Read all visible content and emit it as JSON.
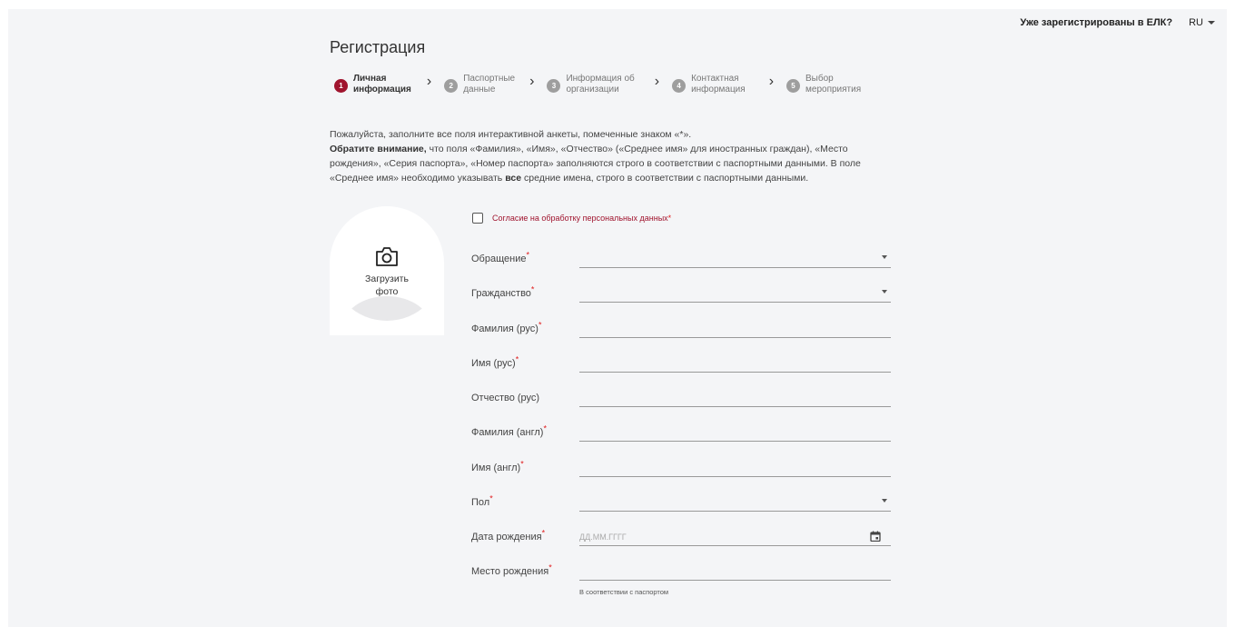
{
  "header": {
    "already_registered": "Уже зарегистрированы в ЕЛК?",
    "language": "RU"
  },
  "page_title": "Регистрация",
  "steps": [
    {
      "num": "1",
      "label": "Личная\nинформация",
      "active": true
    },
    {
      "num": "2",
      "label": "Паспортные\nданные",
      "active": false
    },
    {
      "num": "3",
      "label": "Информация об\nорганизации",
      "active": false
    },
    {
      "num": "4",
      "label": "Контактная\nинформация",
      "active": false
    },
    {
      "num": "5",
      "label": "Выбор\nмероприятия",
      "active": false
    }
  ],
  "intro": {
    "line1": "Пожалуйста, заполните все поля интерактивной анкеты, помеченные знаком «*».",
    "attention_bold": "Обратите внимание,",
    "attention_text": " что поля «Фамилия», «Имя», «Отчество» («Среднее имя» для иностранных граждан), «Место рождения», «Серия паспорта», «Номер паспорта» заполняются строго в соответствии с паспортными данными. В поле «Среднее имя» необходимо указывать ",
    "all_bold": "все",
    "tail": " средние имена, строго в соответствии с паспортными данными."
  },
  "photo": {
    "icon": "camera-icon",
    "label_line1": "Загрузить",
    "label_line2": "фото"
  },
  "consent": {
    "label": "Согласие на обработку персональных данных",
    "checked": false
  },
  "required_mark": "*",
  "form": {
    "salutation": {
      "label": "Обращение",
      "value": ""
    },
    "citizenship": {
      "label": "Гражданство",
      "value": ""
    },
    "last_name_ru": {
      "label": "Фамилия (рус)",
      "value": ""
    },
    "first_name_ru": {
      "label": "Имя (рус)",
      "value": ""
    },
    "patronymic_ru": {
      "label": "Отчество (рус)",
      "value": ""
    },
    "last_name_en": {
      "label": "Фамилия (англ)",
      "value": ""
    },
    "first_name_en": {
      "label": "Имя (англ)",
      "value": ""
    },
    "gender": {
      "label": "Пол",
      "value": ""
    },
    "birth_date": {
      "label": "Дата рождения",
      "placeholder": "ДД.ММ.ГГГГ",
      "value": ""
    },
    "birth_place": {
      "label": "Место рождения",
      "value": "",
      "hint": "В соответствии с паспортом"
    }
  },
  "colors": {
    "accent": "#a0142e",
    "required": "#e02020",
    "background": "#f4f5f7"
  }
}
